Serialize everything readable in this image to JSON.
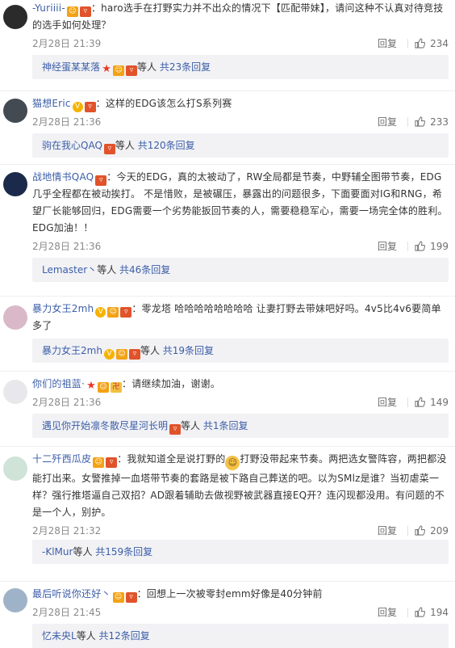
{
  "comments": [
    {
      "user": "-Yuriiii-",
      "badges": [
        "vip",
        "red"
      ],
      "text": "：haro选手在打野实力并不出众的情况下【匹配带妹】，请问这种不认真对待竞技的选手如何处理？",
      "time": "2月28日 21:39",
      "reply": "回复",
      "likes": "234",
      "sub_user": "神经蛋某某落",
      "sub_badges": [
        "star",
        "vip",
        "red"
      ],
      "sub_text": "等人 共23条回复",
      "avatar_color": "#2b2b2b"
    },
    {
      "user": "猫想Eric",
      "badges": [
        "v",
        "red"
      ],
      "text": "：这样的EDG该怎么打S系列赛",
      "time": "2月28日 21:36",
      "reply": "回复",
      "likes": "233",
      "sub_user": "驹在我心QAQ",
      "sub_badges": [
        "red"
      ],
      "sub_text": "等人 共120条回复",
      "avatar_color": "#444a52"
    },
    {
      "user": "战地情书QAQ",
      "badges": [
        "red"
      ],
      "text": "：今天的EDG，真的太被动了，RW全局都是节奏，中野辅全图带节奏，EDG几乎全程都在被动挨打。 不是惜败，是被碾压，暴露出的问题很多，下面要面对IG和RNG，希望厂长能够回归，EDG需要一个劣势能扳回节奏的人，需要稳稳军心，需要一场完全体的胜利。 EDG加油！！",
      "time": "2月28日 21:36",
      "reply": "回复",
      "likes": "199",
      "sub_user": "Lemaster丶",
      "sub_badges": [],
      "sub_text": "等人 共46条回复",
      "avatar_color": "#1b2a4a"
    },
    {
      "user": "暴力女王2mh",
      "badges": [
        "v",
        "vip",
        "red"
      ],
      "text": "：零龙塔 哈哈哈哈哈哈哈哈 让妻打野去带妹吧好吗。4v5比4v6要简单多了",
      "time": "2月28日 21:36",
      "reply": "回复",
      "likes": "192",
      "sub_user": "暴力女王2mh",
      "sub_badges": [
        "v",
        "vip",
        "red"
      ],
      "sub_text": "等人 共19条回复",
      "avatar_color": "#d9b9c8"
    },
    {
      "user": "你们的祖蓝·",
      "badges": [
        "star",
        "vip",
        "gold"
      ],
      "text": "：请继续加油，谢谢。",
      "time": "2月28日 21:36",
      "reply": "回复",
      "likes": "149",
      "sub_user": "遇见你开始凛冬散尽星河长明",
      "sub_badges": [
        "red"
      ],
      "sub_text": "等人 共1条回复",
      "avatar_color": "#e8e8ec"
    },
    {
      "user": "十二歼西瓜皮",
      "badges": [
        "vip",
        "red"
      ],
      "text_pre": "：我就知道全是说打野的",
      "text_post": "打野没带起来节奏。两把选女警阵容，两把都没能打出来。女警推掉一血塔带节奏的套路是被下路自己葬送的吧。以为SMlz是谁？当初虐菜一样？强行推塔逼自己双招？AD跟着辅助去做视野被武器直接EQ开？连闪现都没用。有问题的不是一个人，别护。",
      "time": "2月28日 21:32",
      "reply": "回复",
      "likes": "209",
      "sub_user": "-KlMur",
      "sub_badges": [],
      "sub_text": "等人 共159条回复",
      "avatar_color": "#cfe3d8"
    },
    {
      "user": "最后听说你还好丶",
      "badges": [
        "vip",
        "red"
      ],
      "text": "：回想上一次被零封emm好像是40分钟前",
      "time": "2月28日 21:45",
      "reply": "回复",
      "likes": "194",
      "sub_user": "忆未央L",
      "sub_badges": [],
      "sub_text": "等人 共12条回复",
      "avatar_color": "#9fb3c8"
    }
  ],
  "colors": {
    "link": "#3c5ea8",
    "meta": "#8a8a8a",
    "subbg": "#f2f2f5"
  },
  "icons": {
    "like": "thumbs-up-icon",
    "emoji": "smiley-emoji"
  }
}
